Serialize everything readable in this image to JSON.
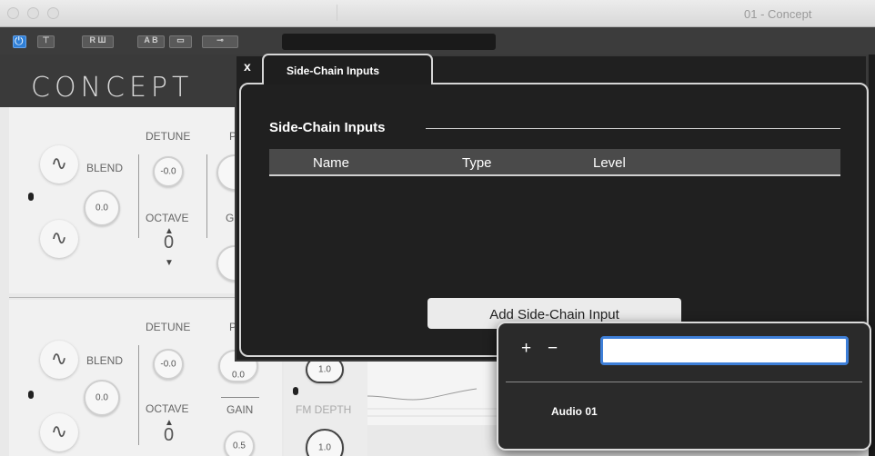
{
  "window": {
    "title": "01 - Concept"
  },
  "toolbar": {
    "buttons": [
      {
        "glyph": ""
      },
      {
        "glyph": "⊤"
      },
      {
        "glyph": "R Ш"
      },
      {
        "glyph": "A B"
      },
      {
        "glyph": "▭"
      },
      {
        "glyph": "⊸"
      }
    ]
  },
  "plugin": {
    "logo": "CONCEPT",
    "osc1": {
      "detune_label": "DETUNE",
      "blend_label": "BLEND",
      "blend_value": "0.0",
      "detune_value": "-0.0",
      "octave_label": "OCTAVE",
      "octave_value": "0",
      "gain_partial": "G",
      "pitch_partial": "P"
    },
    "osc2": {
      "detune_label": "DETUNE",
      "blend_label": "BLEND",
      "blend_value": "0.0",
      "detune_value": "-0.0",
      "octave_label": "OCTAVE",
      "octave_value": "0",
      "gain_label": "GAIN",
      "gain_value": "0.5",
      "fm_depth_label": "FM DEPTH",
      "fm_value": "1.0",
      "pitch_partial": "P",
      "upper_knob_value": "1.0",
      "gain_knob_partial": "0.0"
    }
  },
  "dialog": {
    "close_label": "x",
    "tab_label": "Side-Chain Inputs",
    "section_title": "Side-Chain Inputs",
    "columns": [
      "Name",
      "Type",
      "Level"
    ],
    "add_button_label": "Add Side-Chain Input"
  },
  "popover": {
    "plus_label": "+",
    "minus_label": "−",
    "search_value": "",
    "items": [
      "Audio 01"
    ]
  }
}
